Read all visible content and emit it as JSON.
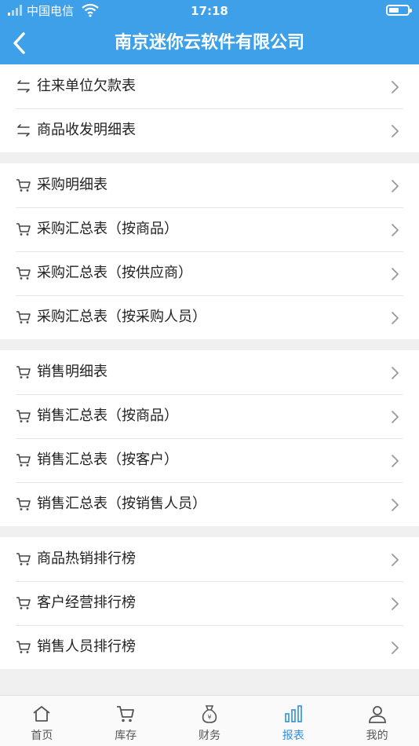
{
  "status_bar": {
    "carrier": "中国电信",
    "time": "17:18"
  },
  "header": {
    "title": "南京迷你云软件有限公司"
  },
  "groups": [
    {
      "items": [
        {
          "label": "往来单位欠款表",
          "icon": "transfer-icon"
        },
        {
          "label": "商品收发明细表",
          "icon": "transfer-icon"
        }
      ]
    },
    {
      "items": [
        {
          "label": "采购明细表",
          "icon": "cart-icon"
        },
        {
          "label": "采购汇总表（按商品）",
          "icon": "cart-icon"
        },
        {
          "label": "采购汇总表（按供应商）",
          "icon": "cart-icon"
        },
        {
          "label": "采购汇总表（按采购人员）",
          "icon": "cart-icon"
        }
      ]
    },
    {
      "items": [
        {
          "label": "销售明细表",
          "icon": "cart-icon"
        },
        {
          "label": "销售汇总表（按商品）",
          "icon": "cart-icon"
        },
        {
          "label": "销售汇总表（按客户）",
          "icon": "cart-icon"
        },
        {
          "label": "销售汇总表（按销售人员）",
          "icon": "cart-icon"
        }
      ]
    },
    {
      "items": [
        {
          "label": "商品热销排行榜",
          "icon": "cart-icon"
        },
        {
          "label": "客户经营排行榜",
          "icon": "cart-icon"
        },
        {
          "label": "销售人员排行榜",
          "icon": "cart-icon"
        }
      ]
    }
  ],
  "tabbar": {
    "active": "报表",
    "tabs": [
      {
        "label": "首页",
        "icon": "home-icon"
      },
      {
        "label": "库存",
        "icon": "cart-icon"
      },
      {
        "label": "财务",
        "icon": "money-bag-icon"
      },
      {
        "label": "报表",
        "icon": "bar-chart-icon"
      },
      {
        "label": "我的",
        "icon": "user-icon"
      }
    ]
  },
  "colors": {
    "accent": "#3fa0ea",
    "active_tab": "#2f8fe0"
  }
}
